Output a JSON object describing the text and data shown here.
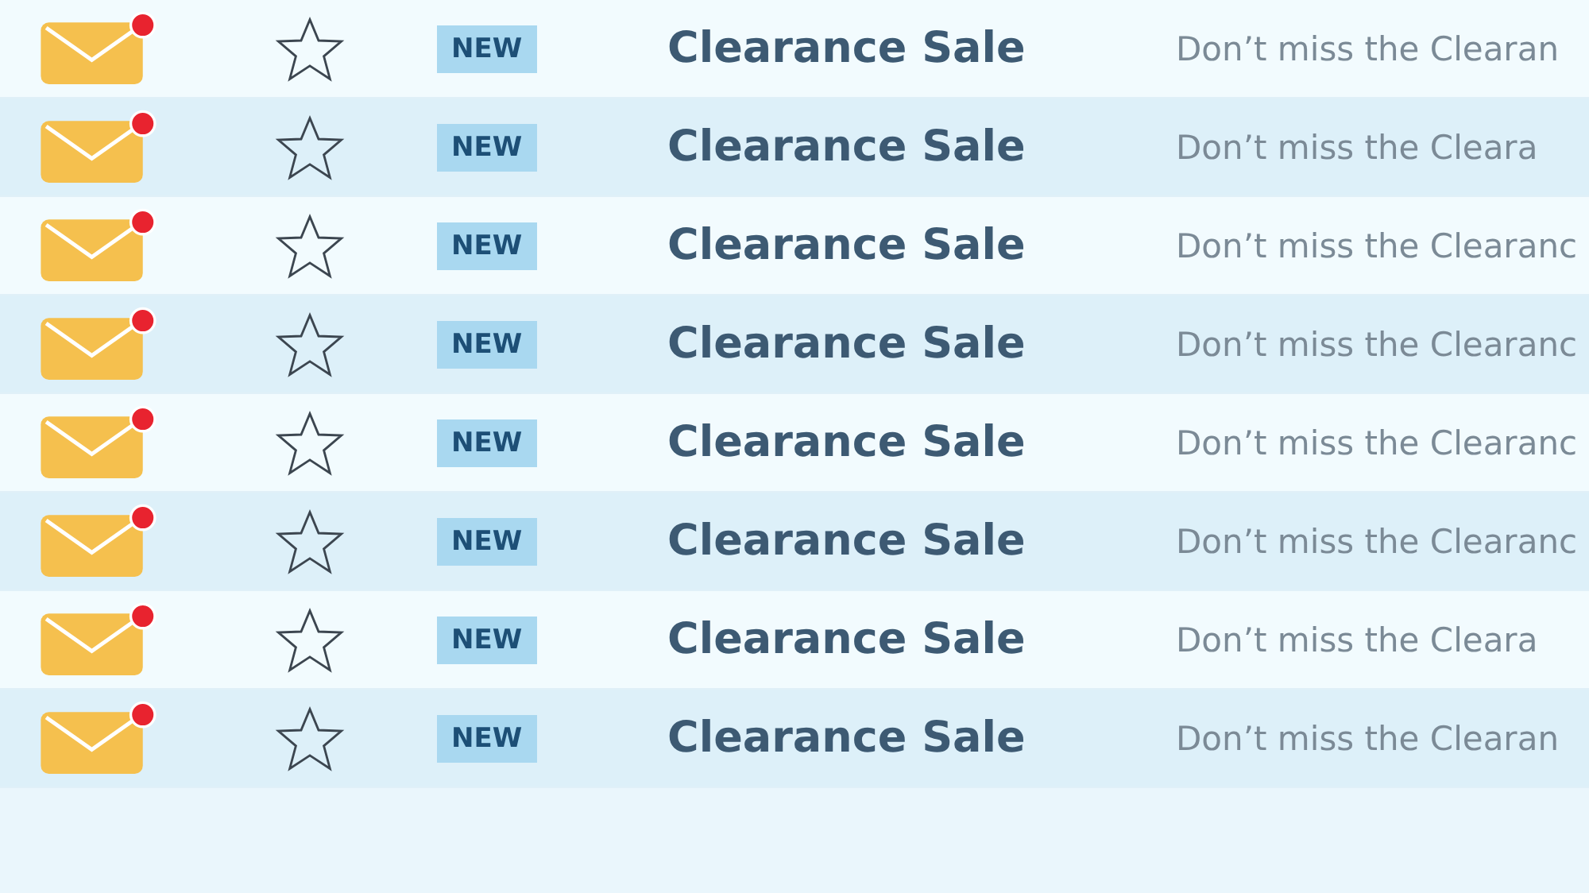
{
  "messages": [
    {
      "unread": true,
      "starred": false,
      "badge": "NEW",
      "subject": "Clearance Sale",
      "preview": "Don’t miss the Clearan"
    },
    {
      "unread": true,
      "starred": false,
      "badge": "NEW",
      "subject": "Clearance Sale",
      "preview": "Don’t miss the Cleara"
    },
    {
      "unread": true,
      "starred": false,
      "badge": "NEW",
      "subject": "Clearance Sale",
      "preview": "Don’t miss the Clearanc"
    },
    {
      "unread": true,
      "starred": false,
      "badge": "NEW",
      "subject": "Clearance Sale",
      "preview": "Don’t miss the Clearanc"
    },
    {
      "unread": true,
      "starred": false,
      "badge": "NEW",
      "subject": "Clearance Sale",
      "preview": "Don’t miss the Clearanc"
    },
    {
      "unread": true,
      "starred": false,
      "badge": "NEW",
      "subject": "Clearance Sale",
      "preview": "Don’t miss the Clearanc"
    },
    {
      "unread": true,
      "starred": false,
      "badge": "NEW",
      "subject": "Clearance Sale",
      "preview": "Don’t miss the Cleara"
    },
    {
      "unread": true,
      "starred": false,
      "badge": "NEW",
      "subject": "Clearance Sale",
      "preview": "Don’t miss the Clearan"
    }
  ]
}
